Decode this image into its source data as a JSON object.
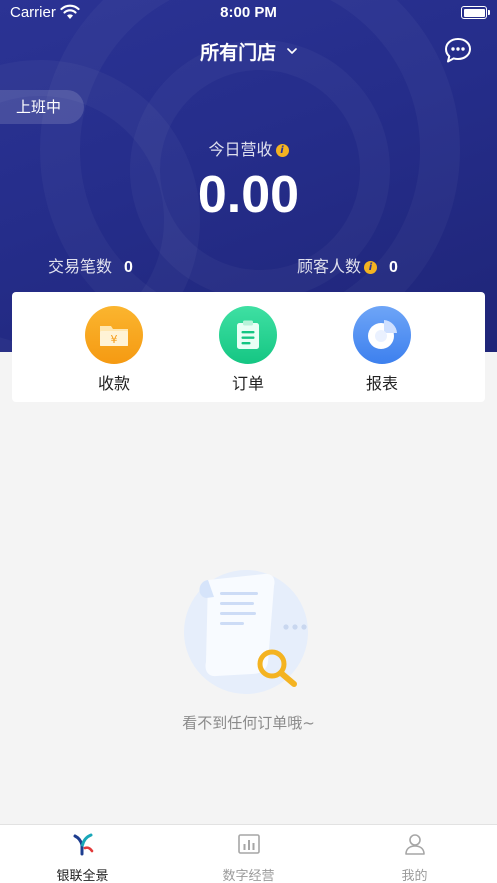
{
  "status_bar": {
    "carrier": "Carrier",
    "time": "8:00 PM"
  },
  "header": {
    "store_selector": "所有门店",
    "on_duty_badge": "上班中",
    "revenue_label": "今日营收",
    "revenue_value": "0.00",
    "transactions_label": "交易笔数",
    "transactions_value": "0",
    "customers_label": "顾客人数",
    "customers_value": "0",
    "info_glyph": "i"
  },
  "actions": [
    {
      "label": "收款",
      "icon": "wallet-icon",
      "color": "#f9a01b",
      "glyph": "¥"
    },
    {
      "label": "订单",
      "icon": "clipboard-icon",
      "color": "#1fcf8c"
    },
    {
      "label": "报表",
      "icon": "pie-chart-icon",
      "color": "#4a8cf0"
    }
  ],
  "empty_state": {
    "message": "看不到任何订单哦~"
  },
  "tabs": [
    {
      "label": "银联全景",
      "icon": "unionpay-logo-icon",
      "active": true
    },
    {
      "label": "数字经营",
      "icon": "bar-chart-icon",
      "active": false
    },
    {
      "label": "我的",
      "icon": "user-icon",
      "active": false
    }
  ],
  "colors": {
    "header_bg": "#2b3394",
    "page_bg": "#f4f4f4",
    "accent_yellow": "#f4b321"
  }
}
